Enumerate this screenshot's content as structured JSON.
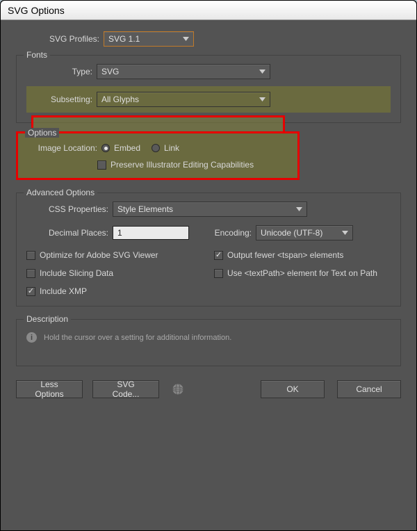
{
  "window": {
    "title": "SVG Options"
  },
  "profiles": {
    "label": "SVG Profiles:",
    "value": "SVG 1.1"
  },
  "fonts": {
    "legend": "Fonts",
    "type_label": "Type:",
    "type_value": "SVG",
    "subsetting_label": "Subsetting:",
    "subsetting_value": "All Glyphs"
  },
  "options": {
    "legend": "Options",
    "image_location_label": "Image Location:",
    "embed": "Embed",
    "link": "Link",
    "preserve": "Preserve Illustrator Editing Capabilities"
  },
  "advanced": {
    "legend": "Advanced Options",
    "css_label": "CSS Properties:",
    "css_value": "Style Elements",
    "decimal_label": "Decimal Places:",
    "decimal_value": "1",
    "encoding_label": "Encoding:",
    "encoding_value": "Unicode (UTF-8)",
    "optimize": "Optimize for Adobe SVG Viewer",
    "output_tspan": "Output fewer <tspan> elements",
    "include_slicing": "Include Slicing Data",
    "use_textpath": "Use <textPath> element for Text on Path",
    "include_xmp": "Include XMP"
  },
  "description": {
    "legend": "Description",
    "text": "Hold the cursor over a setting for additional information."
  },
  "buttons": {
    "less_options": "Less Options",
    "svg_code": "SVG Code...",
    "ok": "OK",
    "cancel": "Cancel"
  }
}
